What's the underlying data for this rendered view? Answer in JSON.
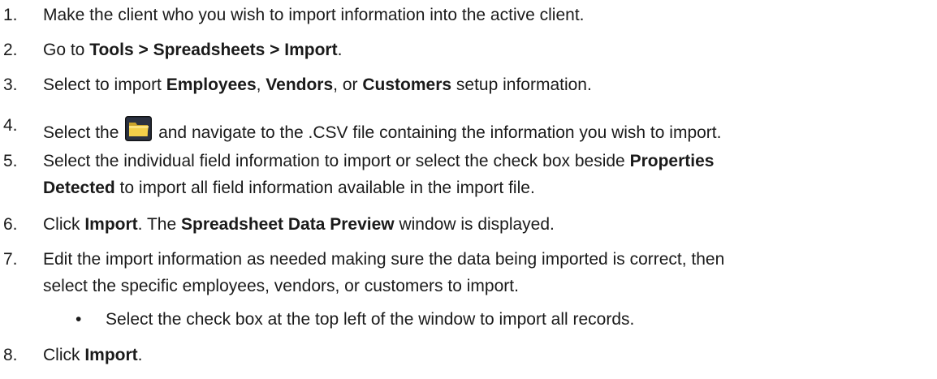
{
  "steps": [
    {
      "n": "1.",
      "parts": [
        "Make the client who you wish to import information into the active client."
      ]
    },
    {
      "n": "2.",
      "parts": [
        "Go to ",
        "Tools > Spreadsheets > Import",
        "."
      ]
    },
    {
      "n": "3.",
      "parts": [
        "Select to import ",
        "Employees",
        ", ",
        "Vendors",
        ", or ",
        "Customers",
        " setup information."
      ]
    },
    {
      "n": "4.",
      "parts": [
        "Select the ",
        " and navigate to the .CSV file containing the information you wish to import."
      ],
      "icon": "folder-icon"
    },
    {
      "n": "5.",
      "parts": [
        "Select the individual field information to import or select the check box beside ",
        "Properties",
        "Detected",
        " to import all field information available in the import file."
      ]
    },
    {
      "n": "6.",
      "parts": [
        "Click ",
        "Import",
        ". The ",
        "Spreadsheet Data Preview",
        " window is displayed."
      ]
    },
    {
      "n": "7.",
      "parts": [
        "Edit the import information as needed making sure the data being imported is correct, then",
        "select the specific employees, vendors, or customers to import."
      ]
    },
    {
      "n": "8.",
      "parts": [
        "Click ",
        "Import",
        "."
      ]
    }
  ],
  "bullet": {
    "symbol": "•",
    "text": "Select the check box at the top left of the window to import all records."
  }
}
